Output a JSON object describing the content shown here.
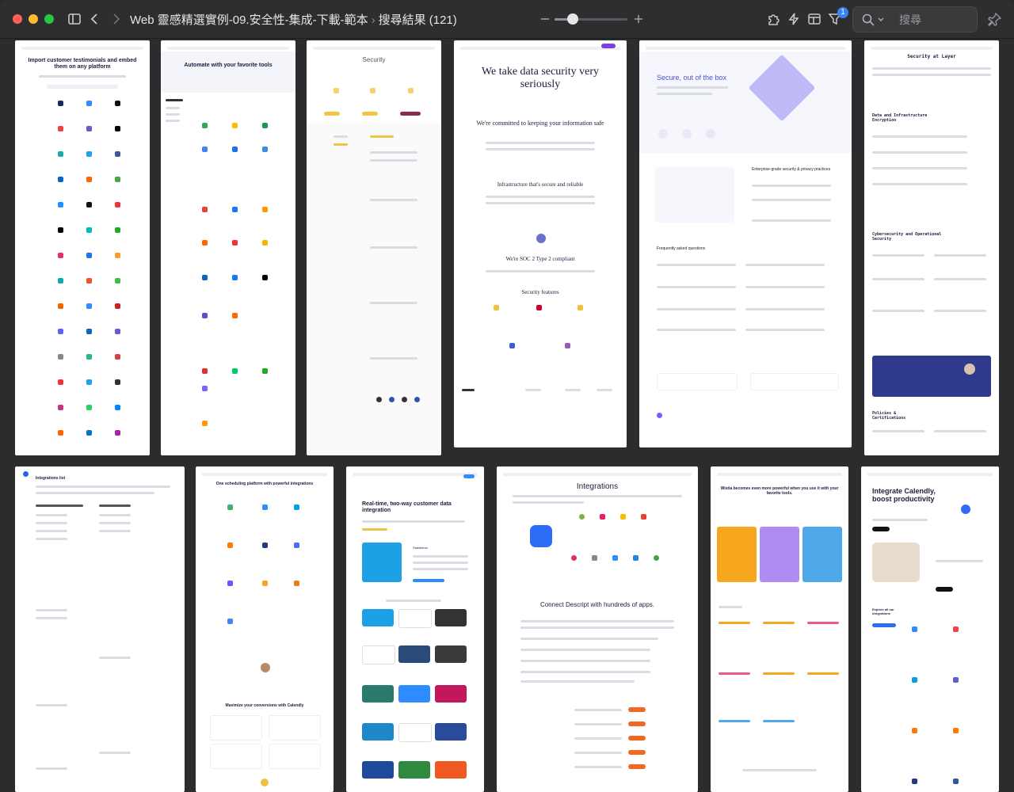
{
  "window": {
    "title": "Web 靈感精選實例-09.安全性-集成-下載-範本",
    "subtitle": "搜尋結果 (121)",
    "filter_badge": "1"
  },
  "search": {
    "placeholder": "搜尋"
  },
  "thumbnails": [
    {
      "heading": "Import customer testimonials and embed them on any platform"
    },
    {
      "heading": "Automate with your favorite tools"
    },
    {
      "heading": "Security"
    },
    {
      "heading": "We take data security very seriously",
      "sub1": "We're committed to keeping your information safe",
      "sub2": "Infrastructure that's secure and reliable",
      "sub3": "We're SOC 2 Type 2 compliant",
      "sub4": "Security features"
    },
    {
      "heading": "Secure, out of the box",
      "sub1": "Frequently asked questions",
      "sub2": "Enterprise-grade security & privacy practices"
    },
    {
      "heading": "Security at Layer",
      "sub1": "Data and Infrastructure Encryption",
      "sub2": "Cybersecurity and Operational Security",
      "sub3": "Policies & Certifications"
    },
    {
      "heading": "Integrations list"
    },
    {
      "heading": "One scheduling platform with powerful integrations",
      "sub1": "Maximize your conversions with Calendly"
    },
    {
      "heading": "Real-time, two-way customer data integration",
      "sub1": "Salesforce"
    },
    {
      "heading": "Integrations",
      "sub1": "Connect Descript with hundreds of apps."
    },
    {
      "heading": "Wistia becomes even more powerful when you use it with your favorite tools."
    },
    {
      "heading": "Integrate Calendly, boost productivity",
      "sub1": "Explore all our integrations"
    }
  ]
}
